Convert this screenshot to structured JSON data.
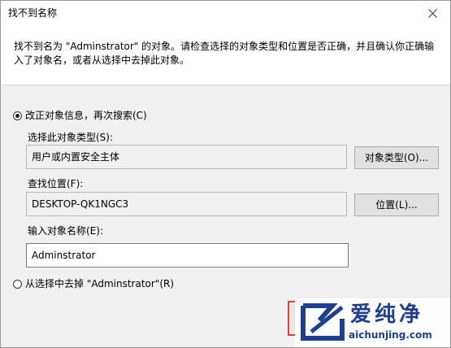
{
  "window": {
    "title": "找不到名称",
    "close_icon": "close-icon"
  },
  "message": "找不到名为 \"Adminstrator\" 的对象。请检查选择的对象类型和位置是否正确，并且确认你正确输入了对象名，或者从选择中去掉此对象。",
  "option_correct": {
    "label": "改正对象信息，再次搜索(C)",
    "selected": true,
    "object_type": {
      "label": "选择此对象类型(S):",
      "value": "用户或内置安全主体",
      "button_label": "对象类型(O)..."
    },
    "location": {
      "label": "查找位置(F):",
      "value": "DESKTOP-QK1NGC3",
      "button_label": "位置(L)..."
    },
    "object_name": {
      "label": "输入对象名称(E):",
      "value": "Adminstrator"
    }
  },
  "option_remove": {
    "label": "从选择中去掉 \"Adminstrator\"(R)",
    "selected": false
  },
  "watermark": {
    "brand": "爱纯净",
    "url": "aichunjing.com",
    "color": "#1f3f8f"
  }
}
